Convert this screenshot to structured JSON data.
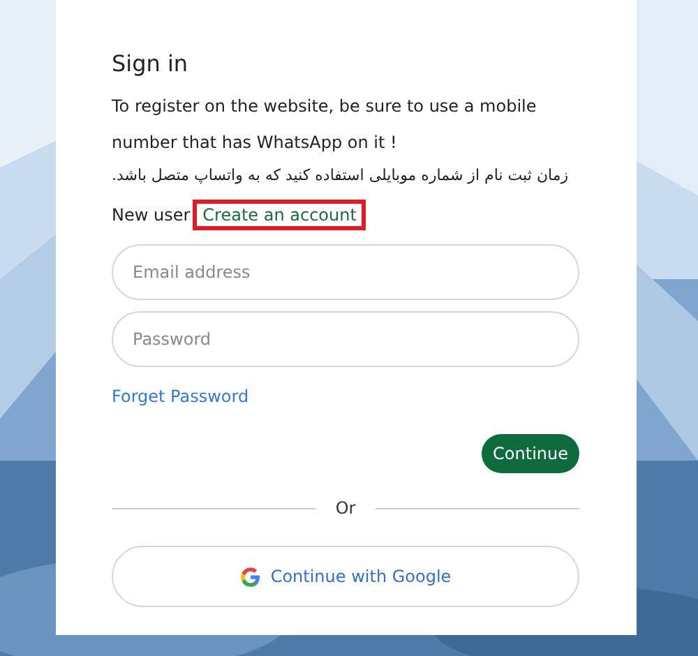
{
  "form": {
    "title": "Sign in",
    "notice": "To register on the website, be sure to use a mobile number that has WhatsApp on it !",
    "notice_fa": "زمان ثبت نام از شماره موبایلی استفاده کنید که به واتساپ متصل باشد.",
    "new_user_label": "New user",
    "create_account": {
      "label": "Create an account",
      "highlighted": true
    },
    "fields": [
      {
        "placeholder": "Email address"
      },
      {
        "placeholder": "Password"
      }
    ],
    "forgot_link": "Forget Password",
    "continue_button": "Continue",
    "divider_label": "Or",
    "google_button": "Continue with Google"
  }
}
